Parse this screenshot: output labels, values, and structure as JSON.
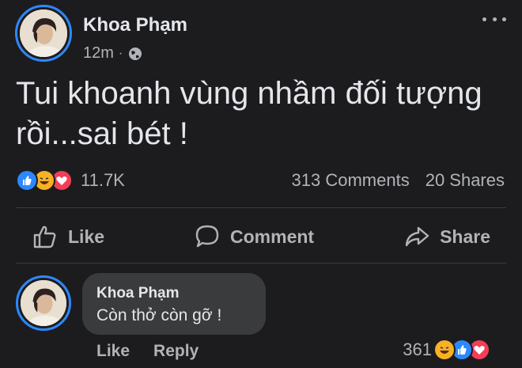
{
  "post": {
    "author": "Khoa Phạm",
    "time": "12m",
    "separator": "·",
    "privacy_icon": "globe-icon",
    "text": "Tui khoanh vùng nhầm đối tượng rồi...sai bét !"
  },
  "stats": {
    "reactions": [
      "like-reaction-icon",
      "haha-reaction-icon",
      "love-reaction-icon"
    ],
    "reaction_count": "11.7K",
    "comments": "313 Comments",
    "shares": "20 Shares"
  },
  "actions": {
    "like": "Like",
    "comment": "Comment",
    "share": "Share"
  },
  "comment": {
    "author": "Khoa Phạm",
    "text": "Còn thở còn gỡ !",
    "like": "Like",
    "reply": "Reply",
    "reaction_count": "361",
    "reactions": [
      "haha-reaction-icon",
      "like-reaction-icon",
      "love-reaction-icon"
    ]
  },
  "colors": {
    "background": "#1c1c1e",
    "accent": "#2d88ff",
    "text_primary": "#e4e6eb",
    "text_secondary": "#b0b3b8",
    "bubble": "#3a3b3c"
  }
}
